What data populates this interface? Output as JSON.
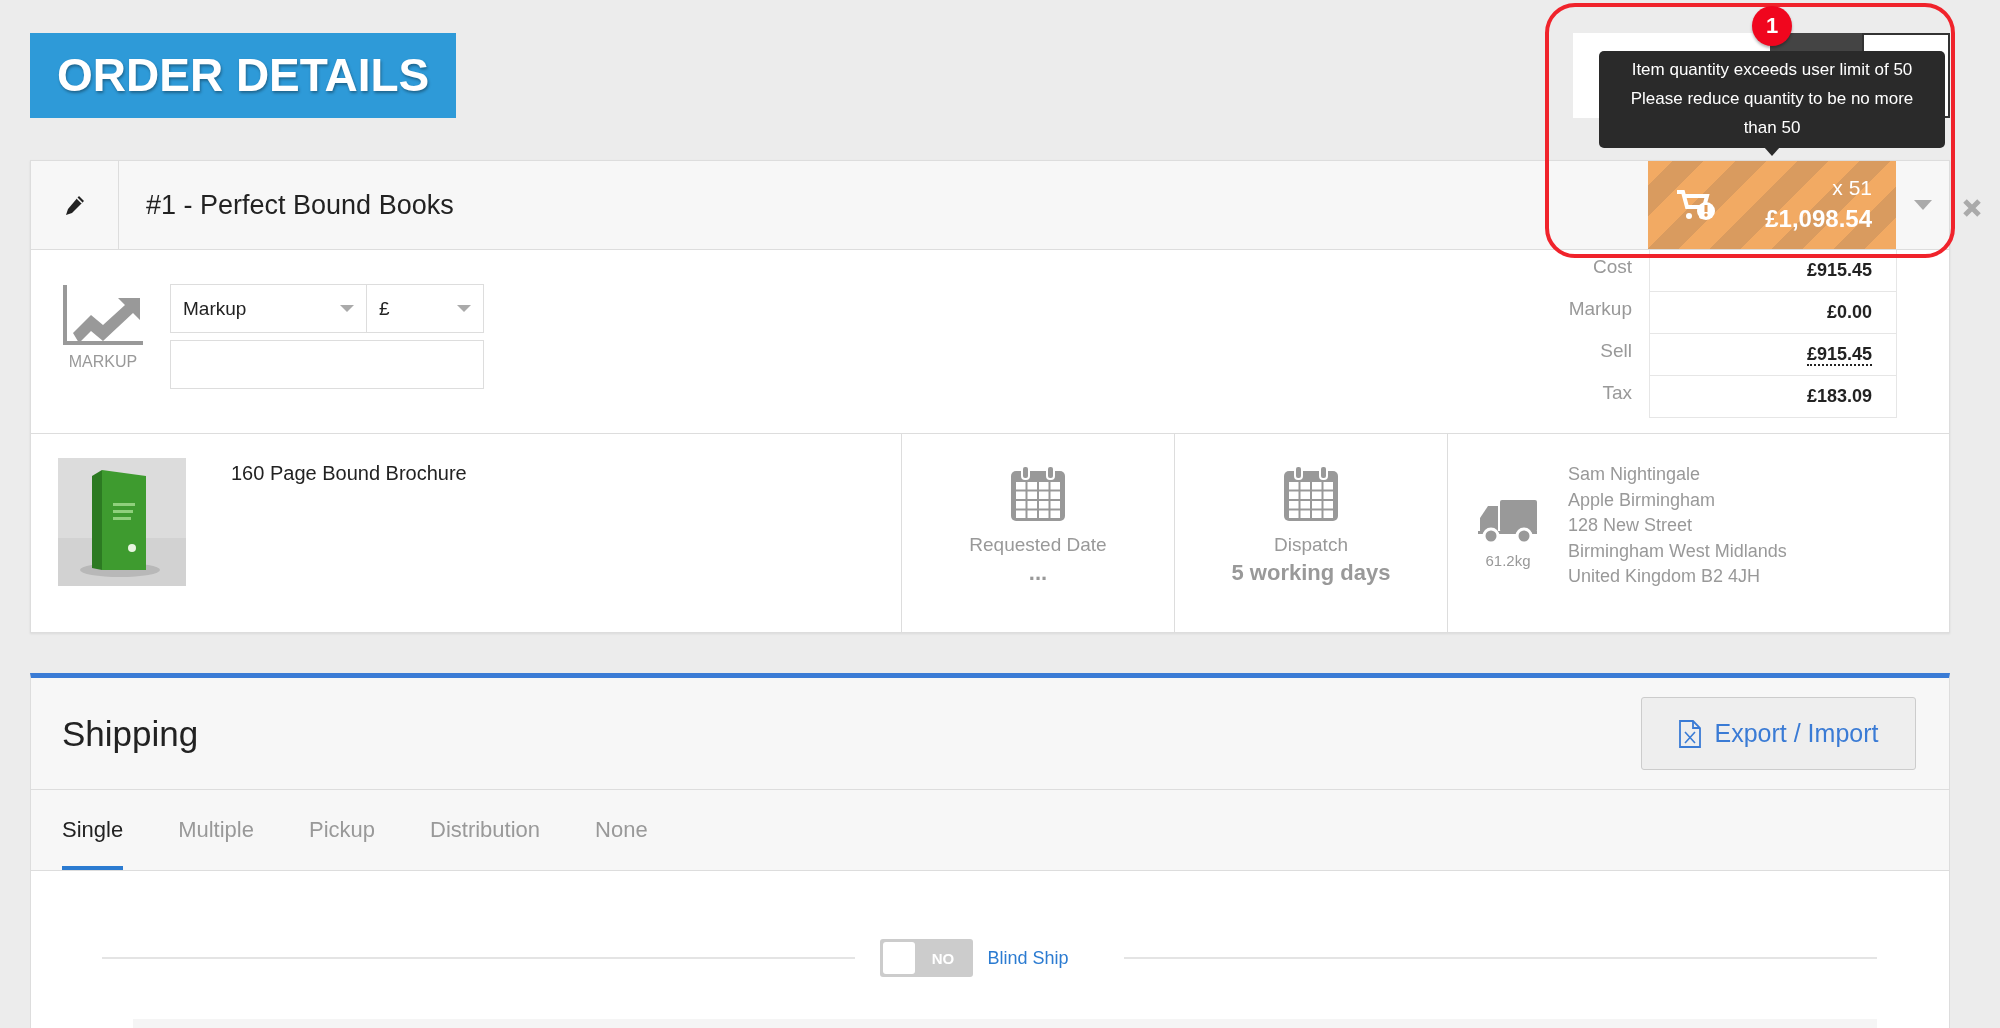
{
  "page_title": "ORDER DETAILS",
  "tooltip": {
    "lines": [
      "Item quantity exceeds user limit of 50",
      "Please reduce quantity to be no more than 50"
    ]
  },
  "annotation": {
    "label": "1"
  },
  "item": {
    "title": "#1 - Perfect Bound Books",
    "quantity": "x 51",
    "total": "£1,098.54",
    "warning": true,
    "markup": {
      "label": "MARKUP",
      "type": "Markup",
      "unit": "£"
    },
    "summary": [
      {
        "label": "Cost",
        "value": "£915.45",
        "dotted": false
      },
      {
        "label": "Markup",
        "value": "£0.00",
        "dotted": false
      },
      {
        "label": "Sell",
        "value": "£915.45",
        "dotted": true
      },
      {
        "label": "Tax",
        "value": "£183.09",
        "dotted": false
      }
    ],
    "product": {
      "name": "160 Page Bound Brochure",
      "kind": "picture"
    },
    "requested_date": {
      "label": "Requested Date",
      "value": "..."
    },
    "dispatch": {
      "label": "Dispatch",
      "value": "5 working days"
    },
    "weight": "61.2kg",
    "address": [
      "Sam Nightingale",
      "Apple Birmingham",
      "128 New Street",
      "Birmingham West Midlands",
      "United Kingdom B2 4JH"
    ]
  },
  "shipping": {
    "title": "Shipping",
    "export_button": "Export / Import",
    "tabs": [
      {
        "label": "Single",
        "selected": true
      },
      {
        "label": "Multiple",
        "selected": false
      },
      {
        "label": "Pickup",
        "selected": false
      },
      {
        "label": "Distribution",
        "selected": false
      },
      {
        "label": "None",
        "selected": false
      }
    ],
    "blind_ship": {
      "label": "Blind Ship",
      "on": false,
      "state_text": "NO"
    }
  }
}
